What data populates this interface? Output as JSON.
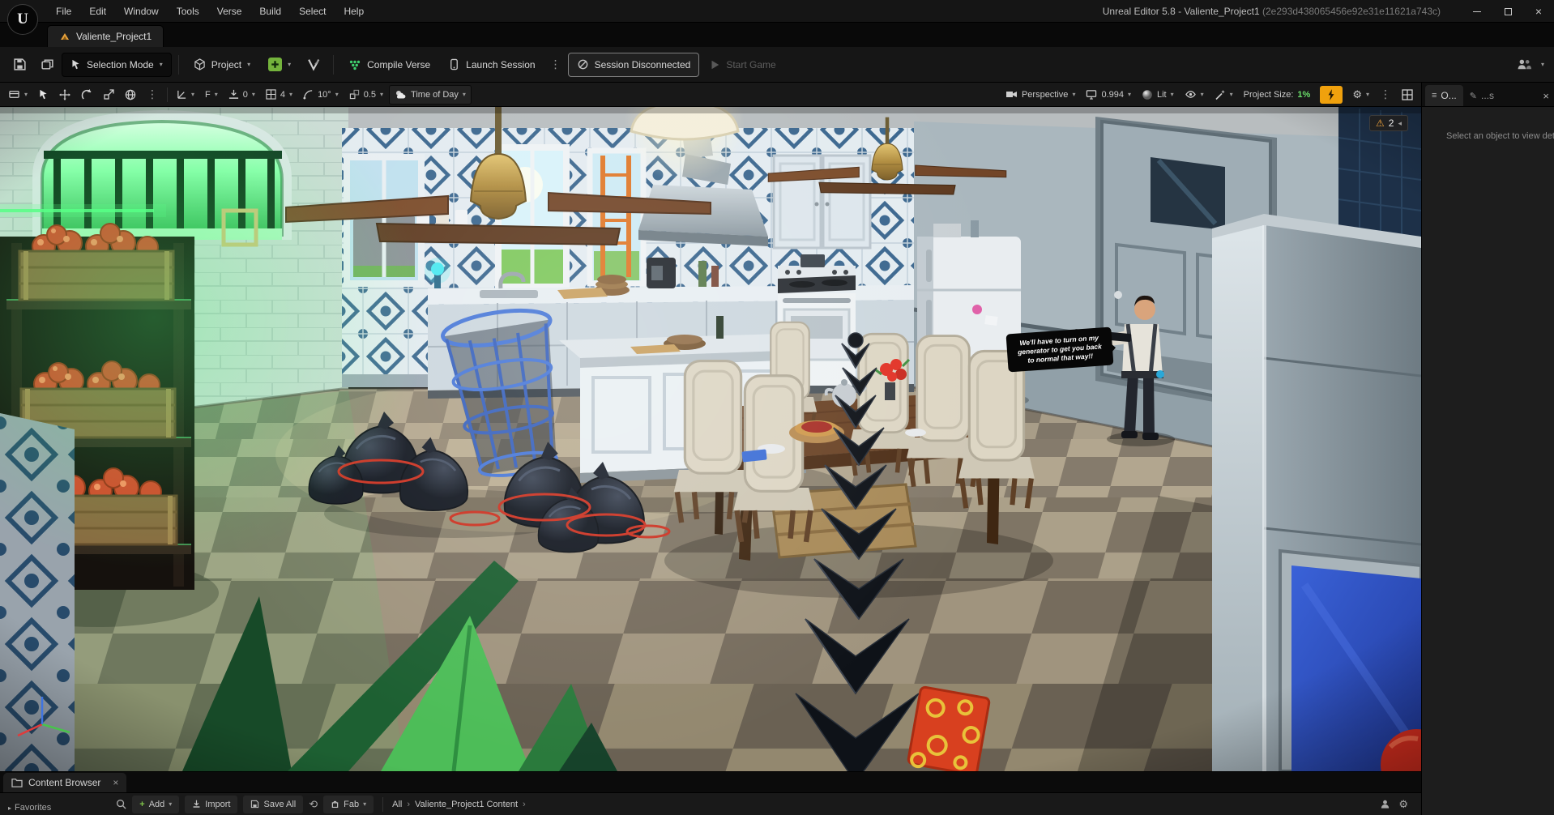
{
  "colors": {
    "accent_green": "#74b33c",
    "warning_orange": "#f0a33c",
    "bolt_orange": "#f0a10d",
    "project_size_green": "#6ade6a"
  },
  "titlebar": {
    "menus": [
      "File",
      "Edit",
      "Window",
      "Tools",
      "Verse",
      "Build",
      "Select",
      "Help"
    ],
    "title": "Unreal Editor 5.8 - Valiente_Project1",
    "guid": "(2e293d438065456e92e31e11621a743c)"
  },
  "project_tab": {
    "label": "Valiente_Project1"
  },
  "toolbar": {
    "selection_mode": "Selection Mode",
    "project": "Project",
    "compile_verse": "Compile Verse",
    "launch_session": "Launch Session",
    "session_disconnected": "Session Disconnected",
    "start_game": "Start Game"
  },
  "viewport_toolbar": {
    "camera_speed": "F",
    "snap_move": "0",
    "snap_grid": "4",
    "snap_rotate": "10°",
    "snap_scale": "0.5",
    "time_of_day": "Time of Day",
    "perspective": "Perspective",
    "screen_percentage": "0.994",
    "lit": "Lit",
    "project_size_label": "Project Size:",
    "project_size_value": "1%"
  },
  "viewport": {
    "warning_count": "2",
    "npc_speech": "We'll have to turn on my generator to get you back to normal that way!!"
  },
  "outliner_panel": {
    "tab_outliner": "O...",
    "tab_second": "...s",
    "empty_message": "Select an object to view det"
  },
  "content_browser": {
    "tab": "Content Browser",
    "favorites": "Favorites",
    "add": "Add",
    "import": "Import",
    "save_all": "Save All",
    "fab": "Fab",
    "breadcrumb_root": "All",
    "breadcrumb_path": "Valiente_Project1 Content"
  }
}
